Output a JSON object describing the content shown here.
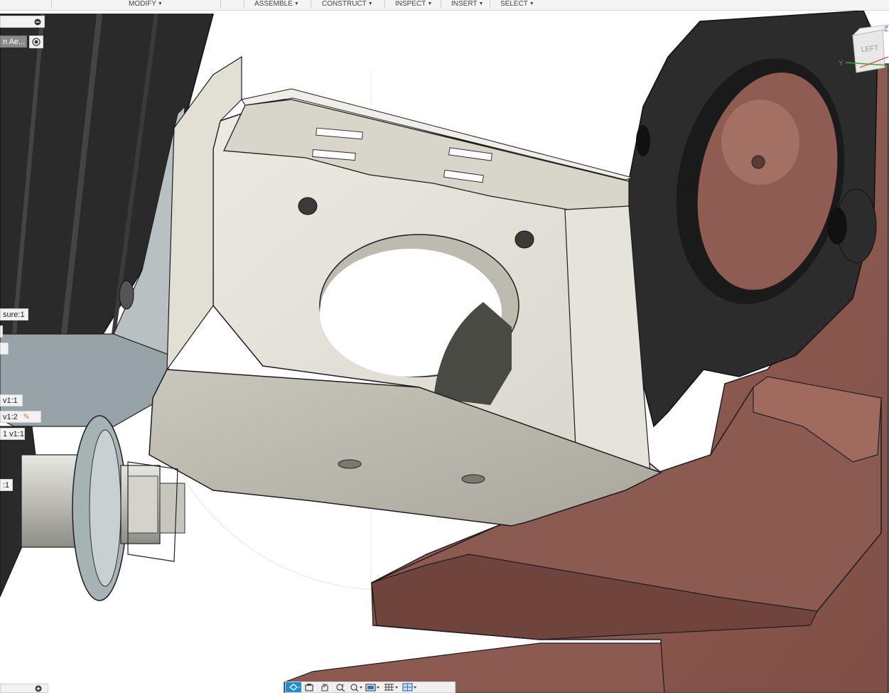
{
  "toolbar": {
    "menus": [
      {
        "label": "MODIFY"
      },
      {
        "label": "ASSEMBLE"
      },
      {
        "label": "CONSTRUCT"
      },
      {
        "label": "INSPECT"
      },
      {
        "label": "INSERT"
      },
      {
        "label": "SELECT"
      }
    ]
  },
  "browser": {
    "top_item": "",
    "active_component": "n Ae...",
    "items": [
      {
        "label": "sure:1"
      },
      {
        "label": "v1:1"
      },
      {
        "label": "v1:2"
      },
      {
        "label": "1 v1:1"
      },
      {
        "label": ":1"
      }
    ]
  },
  "viewcube": {
    "face_label": "LEFT",
    "axis_y": "Y",
    "axis_z": "Z"
  },
  "colors": {
    "accent": "#1e8fd6",
    "bracket": "#e3e1d7",
    "copper": "#8e5b52",
    "dark_part": "#2b2b2b"
  }
}
